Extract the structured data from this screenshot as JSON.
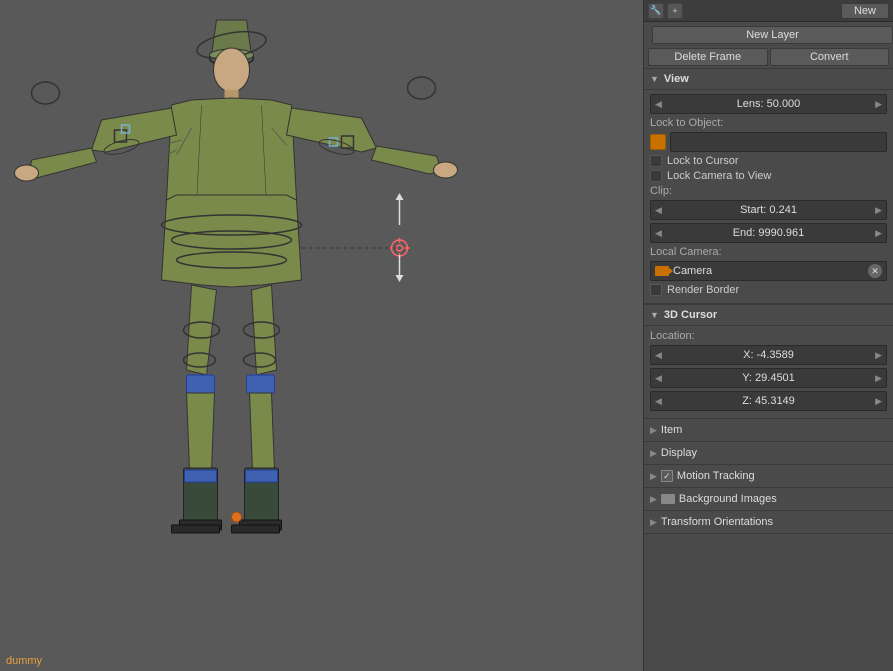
{
  "toolbar": {
    "new_label": "New",
    "new_layer_label": "New Layer",
    "delete_frame_label": "Delete Frame",
    "convert_label": "Convert"
  },
  "view_section": {
    "title": "View",
    "lens_label": "Lens: 50.000",
    "lock_to_object_label": "Lock to Object:",
    "lock_to_cursor_label": "Lock to Cursor",
    "lock_camera_label": "Lock Camera to View",
    "clip_label": "Clip:",
    "start_label": "Start: 0.241",
    "end_label": "End: 9990.961",
    "local_camera_label": "Local Camera:",
    "camera_name": "Camera",
    "render_border_label": "Render Border"
  },
  "cursor_section": {
    "title": "3D Cursor",
    "location_label": "Location:",
    "x_label": "X: -4.3589",
    "y_label": "Y: 29.4501",
    "z_label": "Z: 45.3149"
  },
  "collapsed_sections": {
    "item_label": "Item",
    "display_label": "Display",
    "motion_tracking_label": "Motion Tracking",
    "background_images_label": "Background Images",
    "transform_orientations_label": "Transform Orientations"
  },
  "viewport_label": "dummy",
  "icons": {
    "wrench": "🔧",
    "plus": "+",
    "triangle_down": "▼",
    "triangle_right": "▶",
    "arrow_left": "◀",
    "arrow_right": "▶"
  }
}
